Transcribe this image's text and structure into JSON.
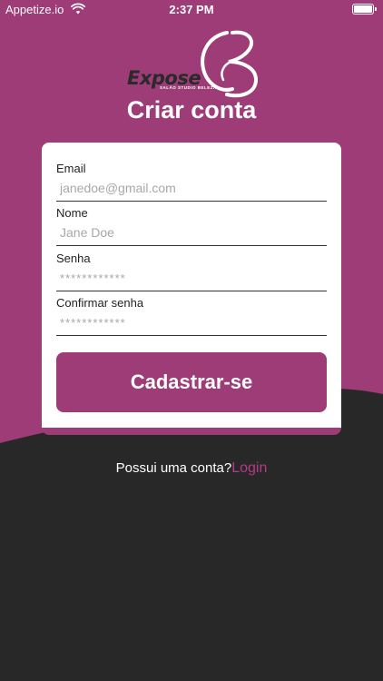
{
  "status_bar": {
    "carrier": "Appetize.io",
    "time": "2:37 PM"
  },
  "logo": {
    "wordmark": "Expose",
    "tagline": "SALÃO  STUDIO  BELEZA"
  },
  "page": {
    "title": "Criar conta"
  },
  "form": {
    "email": {
      "label": "Email",
      "placeholder": "janedoe@gmail.com"
    },
    "name": {
      "label": "Nome",
      "placeholder": "Jane Doe"
    },
    "password": {
      "label": "Senha",
      "placeholder": "************"
    },
    "confirm_password": {
      "label": "Confirmar senha",
      "placeholder": "************"
    },
    "submit_label": "Cadastrar-se"
  },
  "footer": {
    "question": "Possui uma conta?",
    "login_label": "Login"
  },
  "colors": {
    "primary": "#9d3c77",
    "dark": "#282828",
    "link": "#b23a87"
  }
}
